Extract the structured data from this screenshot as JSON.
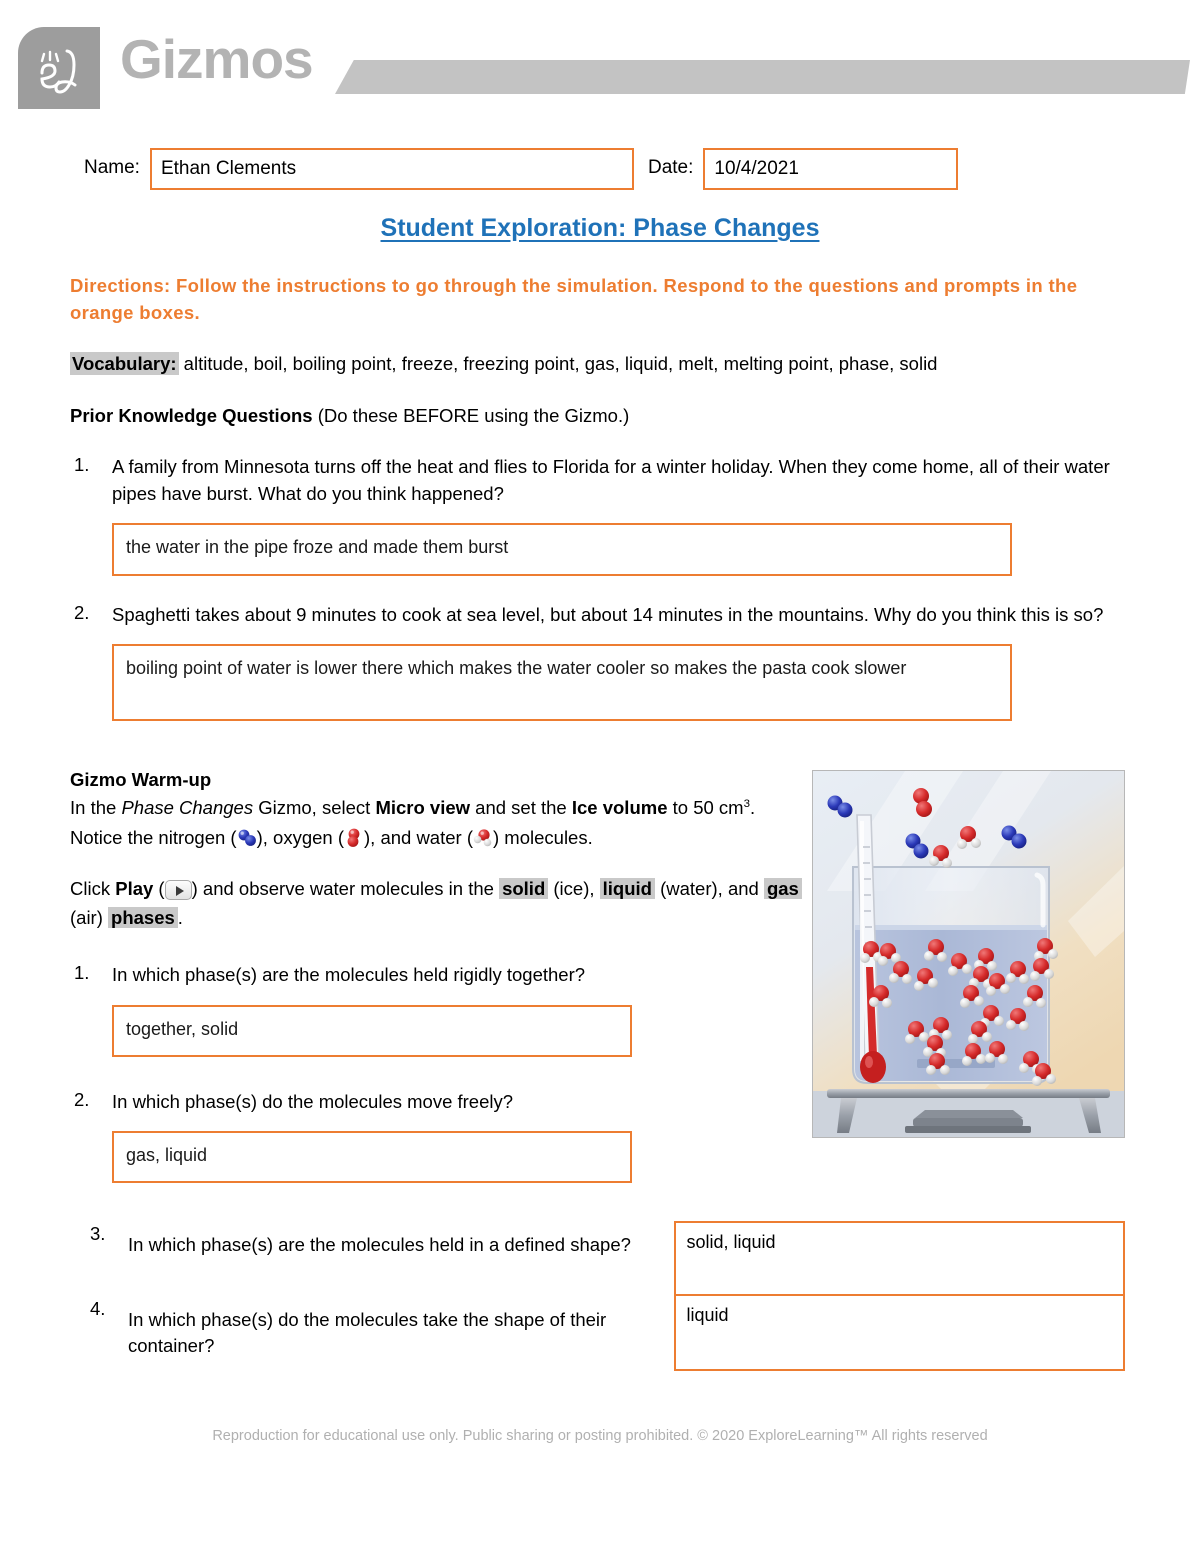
{
  "brand": {
    "name": "Gizmos",
    "logo_icon": "el-script-logo-icon"
  },
  "header_fields": {
    "name_label": "Name:",
    "name_value": "Ethan Clements",
    "date_label": "Date:",
    "date_value": "10/4/2021"
  },
  "title": "Student Exploration: Phase Changes",
  "directions": "Directions: Follow the instructions to go through the simulation. Respond to the questions and prompts in the orange boxes.",
  "vocabulary": {
    "label": "Vocabulary:",
    "terms": " altitude, boil, boiling point, freeze, freezing point, gas, liquid, melt, melting point, phase, solid"
  },
  "prior_knowledge": {
    "heading": "Prior Knowledge Questions",
    "note": " (Do these BEFORE using the Gizmo.)",
    "questions": [
      {
        "num": "1.",
        "text": "A family from Minnesota turns off the heat and flies to Florida for a winter holiday. When they come home, all of their water pipes have burst. What do you think happened?",
        "answer": "the water in the pipe froze and made them burst"
      },
      {
        "num": "2.",
        "text": "Spaghetti takes about 9 minutes to cook at sea level, but about 14 minutes in the mountains. Why do you think this is so?",
        "answer": "boiling point of water is lower there which makes the water cooler so makes the pasta cook slower"
      }
    ]
  },
  "warmup": {
    "heading": "Gizmo Warm-up",
    "p1_a": "In the ",
    "p1_italic": "Phase Changes",
    "p1_b": " Gizmo, select ",
    "p1_bold1": "Micro view",
    "p1_c": " and set the ",
    "p1_bold2": "Ice volume",
    "p1_d": " to 50 cm",
    "p1_sup": "3",
    "p1_e": ". Notice the nitrogen (",
    "p1_f": "), oxygen (",
    "p1_g": "), and water (",
    "p1_h": ") molecules.",
    "p2_a": "Click ",
    "p2_bold_play": "Play",
    "p2_b": " (",
    "p2_c": ") and observe water molecules in the ",
    "p2_hl1": "solid",
    "p2_d": " (ice), ",
    "p2_hl2": "liquid",
    "p2_e": " (water), and ",
    "p2_hl3": "gas",
    "p2_f": " (air) ",
    "p2_hl4": "phases",
    "p2_g": ".",
    "icons": {
      "nitrogen": "nitrogen-molecule-icon",
      "oxygen": "oxygen-molecule-icon",
      "water": "water-molecule-icon",
      "play": "play-button-icon"
    },
    "questions": [
      {
        "num": "1.",
        "text": "In which phase(s) are the molecules held rigidly together?",
        "answer": "together, solid"
      },
      {
        "num": "2.",
        "text": "In which phase(s) do the molecules move freely?",
        "answer": "gas, liquid"
      }
    ],
    "split_questions": [
      {
        "num": "3.",
        "text": "In which phase(s) are the molecules held in a defined shape?",
        "answer": "solid, liquid"
      },
      {
        "num": "4.",
        "text": "In which phase(s) do the molecules take the shape of their container?",
        "answer": "liquid"
      }
    ],
    "simulation_image_alt": "beaker-with-thermometer-and-molecules-illustration"
  },
  "footer": "Reproduction for educational use only. Public sharing or posting prohibited. © 2020 ExploreLearning™ All rights reserved",
  "colors": {
    "accent_orange": "#ED7D31",
    "title_blue": "#1F72B8",
    "logo_gray": "#9d9d9d",
    "brand_gray": "#b3b3b3"
  }
}
